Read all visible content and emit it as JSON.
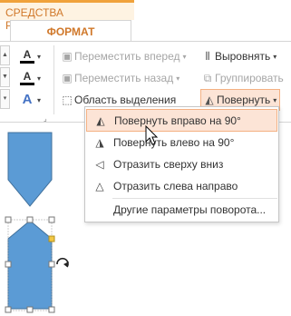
{
  "context_tab": {
    "label": "СРЕДСТВА РИСОВАНИЯ"
  },
  "active_tab": {
    "label": "ФОРМАТ"
  },
  "ribbon": {
    "style_buttons": [
      {
        "glyph": "A"
      },
      {
        "glyph": "A"
      },
      {
        "glyph": "A"
      }
    ],
    "arrange": {
      "bring_forward": "Переместить вперед",
      "send_backward": "Переместить назад",
      "selection_pane": "Область выделения",
      "align": "Выровнять",
      "group": "Группировать",
      "rotate": "Повернуть"
    }
  },
  "rotate_menu": {
    "items": [
      {
        "label": "Повернуть вправо на 90°",
        "icon": "rotate-right-icon"
      },
      {
        "label": "Повернуть влево на 90°",
        "icon": "rotate-left-icon"
      },
      {
        "label": "Отразить сверху вниз",
        "icon": "flip-vertical-icon"
      },
      {
        "label": "Отразить слева направо",
        "icon": "flip-horizontal-icon"
      },
      {
        "label": "Другие параметры поворота...",
        "icon": ""
      }
    ]
  },
  "colors": {
    "accent": "#d0782a",
    "shape_fill": "#5b9bd5",
    "shape_stroke": "#41719c",
    "highlight": "#fce4d6"
  }
}
